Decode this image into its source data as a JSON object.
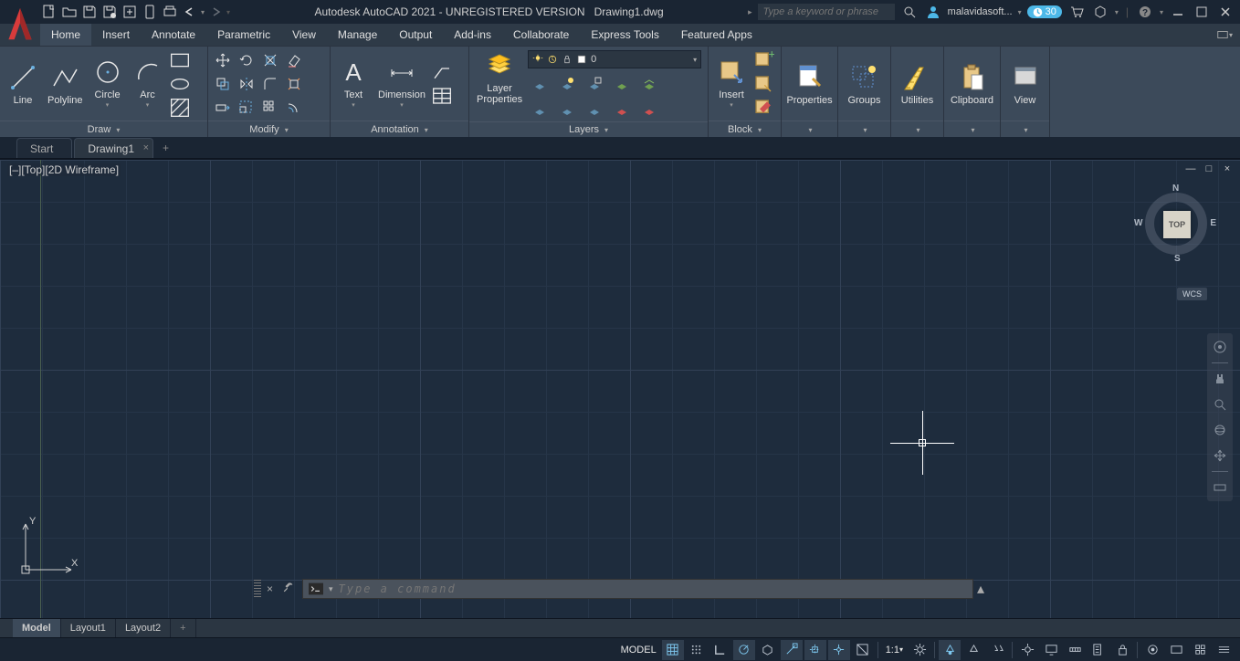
{
  "titlebar": {
    "app_title": "Autodesk AutoCAD 2021 - UNREGISTERED VERSION",
    "doc_name": "Drawing1.dwg",
    "search_placeholder": "Type a keyword or phrase",
    "user": "malavidasoft...",
    "trial_days": "30"
  },
  "ribbon_tabs": [
    "Home",
    "Insert",
    "Annotate",
    "Parametric",
    "View",
    "Manage",
    "Output",
    "Add-ins",
    "Collaborate",
    "Express Tools",
    "Featured Apps"
  ],
  "ribbon_active": "Home",
  "panels": {
    "draw": {
      "title": "Draw",
      "tools": {
        "line": "Line",
        "polyline": "Polyline",
        "circle": "Circle",
        "arc": "Arc"
      }
    },
    "modify": {
      "title": "Modify"
    },
    "annotation": {
      "title": "Annotation",
      "text": "Text",
      "dimension": "Dimension"
    },
    "layers": {
      "title": "Layers",
      "layer_properties": "Layer\nProperties",
      "current_layer": "0"
    },
    "block": {
      "title": "Block",
      "insert": "Insert"
    },
    "properties": {
      "title": "Properties"
    },
    "groups": {
      "title": "Groups"
    },
    "utilities": {
      "title": "Utilities"
    },
    "clipboard": {
      "title": "Clipboard"
    },
    "view": {
      "title": "View"
    }
  },
  "file_tabs": {
    "start": "Start",
    "drawing": "Drawing1"
  },
  "viewport": {
    "label": "[–][Top][2D Wireframe]",
    "cube_face": "TOP",
    "wcs": "WCS"
  },
  "layout_tabs": [
    "Model",
    "Layout1",
    "Layout2"
  ],
  "command": {
    "placeholder": "Type a command"
  },
  "status": {
    "model": "MODEL",
    "scale": "1:1"
  }
}
